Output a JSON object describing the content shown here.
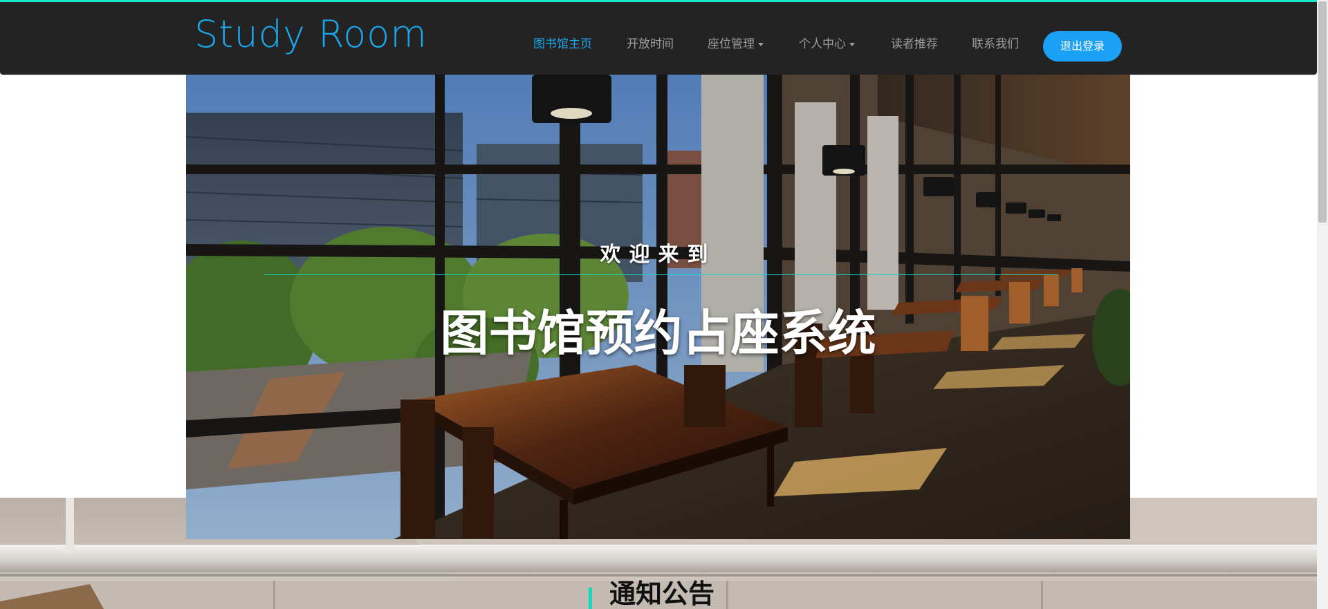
{
  "brand": "Study Room",
  "nav": {
    "items": [
      {
        "label": "图书馆主页",
        "active": true
      },
      {
        "label": "开放时间"
      },
      {
        "label": "座位管理",
        "dropdown": true
      },
      {
        "label": "个人中心",
        "dropdown": true
      },
      {
        "label": "读者推荐"
      },
      {
        "label": "联系我们"
      }
    ],
    "logout": "退出登录"
  },
  "hero": {
    "welcome": "欢迎来到",
    "title": "图书馆预约占座系统"
  },
  "section": {
    "title": "通知公告"
  },
  "colors": {
    "navbar_bg": "#232323",
    "accent": "#1aa8ef",
    "teal": "#19d6c2",
    "logout_btn": "#1aa0f5"
  }
}
